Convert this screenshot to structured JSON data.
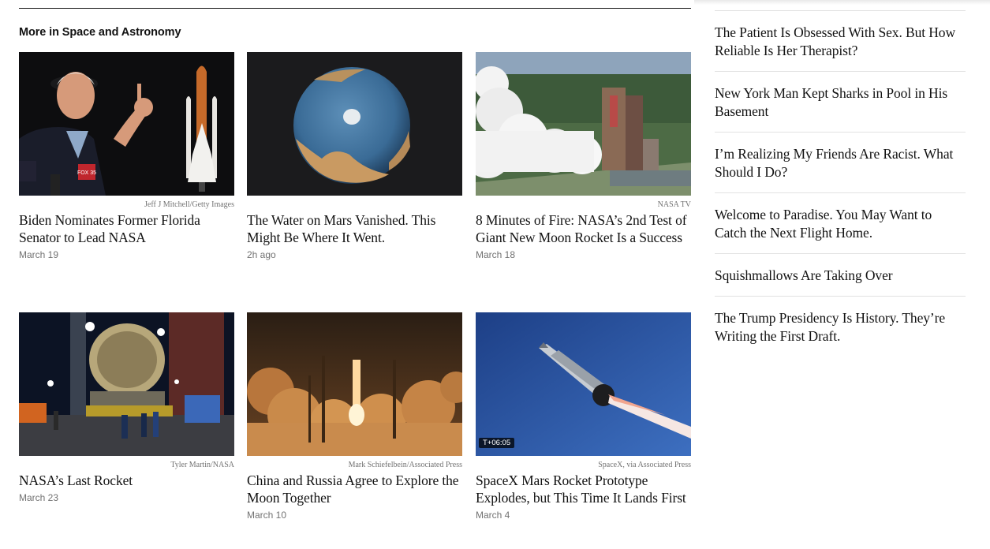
{
  "section": {
    "title": "More in Space and Astronomy"
  },
  "cards": [
    {
      "credit": "Jeff J Mitchell/Getty Images",
      "headline": "Biden Nominates Former Florida Senator to Lead NASA",
      "date": "March 19"
    },
    {
      "credit": "",
      "headline": "The Water on Mars Vanished. This Might Be Where It Went.",
      "date": "2h ago"
    },
    {
      "credit": "NASA TV",
      "headline": "8 Minutes of Fire: NASA’s 2nd Test of Giant New Moon Rocket Is a Success",
      "date": "March 18"
    },
    {
      "credit": "Tyler Martin/NASA",
      "headline": "NASA’s Last Rocket",
      "date": "March 23"
    },
    {
      "credit": "Mark Schiefelbein/Associated Press",
      "headline": "China and Russia Agree to Explore the Moon Together",
      "date": "March 10"
    },
    {
      "credit": "SpaceX, via Associated Press",
      "headline": "SpaceX Mars Rocket Prototype Explodes, but This Time It Lands First",
      "date": "March 4",
      "video_time": "T+06:05"
    }
  ],
  "rail": {
    "items": [
      "The Patient Is Obsessed With Sex. But How Reliable Is Her Therapist?",
      "New York Man Kept Sharks in Pool in His Basement",
      "I’m Realizing My Friends Are Racist. What Should I Do?",
      "Welcome to Paradise. You May Want to Catch the Next Flight Home.",
      "Squishmallows Are Taking Over",
      "The Trump Presidency Is History. They’re Writing the First Draft."
    ]
  },
  "logos": {
    "news_mic_logo": "FOX 35"
  }
}
